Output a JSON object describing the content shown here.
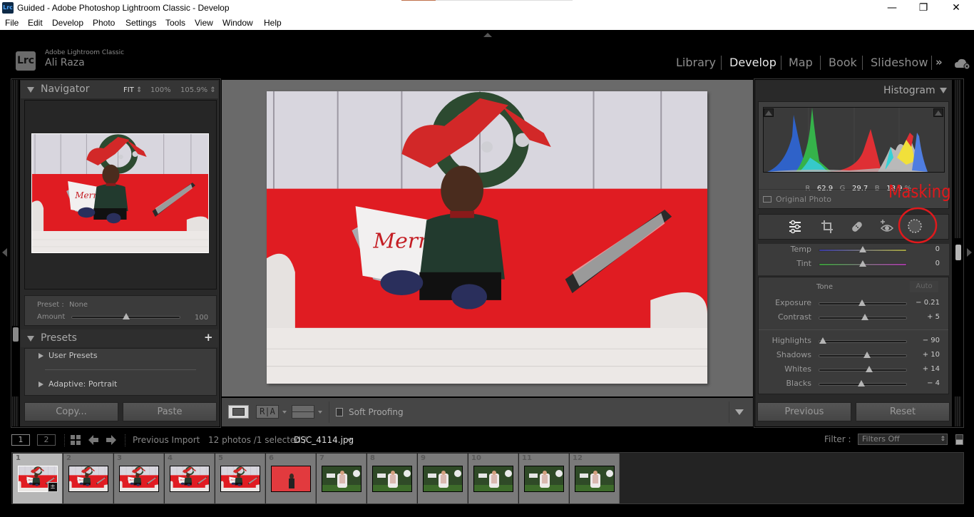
{
  "window": {
    "app_icon": "Lrc",
    "title": "Guided - Adobe Photoshop Lightroom Classic - Develop",
    "controls": {
      "minimize": "—",
      "restore": "❐",
      "close": "✕"
    }
  },
  "menu": [
    "File",
    "Edit",
    "Develop",
    "Photo",
    "Settings",
    "Tools",
    "View",
    "Window",
    "Help"
  ],
  "identity": {
    "badge": "Lrc",
    "product": "Adobe Lightroom Classic",
    "user": "Ali Raza"
  },
  "modules": {
    "items": [
      "Library",
      "Develop",
      "Map",
      "Book",
      "Slideshow"
    ],
    "active": "Develop",
    "more": "»",
    "cloud_icon": "cloud-sync-icon"
  },
  "navigator": {
    "title": "Navigator",
    "zoom_options": [
      "FIT",
      "100%",
      "105.9%"
    ],
    "selected_zoom": "FIT"
  },
  "preset_amount": {
    "preset_label": "Preset :",
    "preset_value": "None",
    "amount_label": "Amount",
    "amount_value": "100",
    "amount_fraction": 0.5
  },
  "presets": {
    "title": "Presets",
    "add": "+",
    "items": [
      "User Presets",
      "Adaptive: Portrait"
    ]
  },
  "left_buttons": {
    "copy": "Copy...",
    "paste": "Paste"
  },
  "toolbar": {
    "view_mode_icon": "loupe-view-icon",
    "before_after": "R|A",
    "before_after_split": "Y|Y",
    "soft_proofing": "Soft Proofing",
    "soft_proofing_checked": false
  },
  "histogram": {
    "title": "Histogram",
    "readout": {
      "r_label": "R",
      "r": "62.9",
      "g_label": "G",
      "g": "29.7",
      "b_label": "B",
      "b": "18.9",
      "unit": "%"
    },
    "original_photo": "Original Photo"
  },
  "annotation": {
    "text": "Masking",
    "color": "#e0191c"
  },
  "tool_strip": [
    "edit-sliders-icon",
    "crop-icon",
    "healing-icon",
    "red-eye-icon",
    "masking-icon"
  ],
  "basic": {
    "wb": [
      {
        "label": "Temp",
        "value": "0",
        "pos": 0.5
      },
      {
        "label": "Tint",
        "value": "0",
        "pos": 0.5
      }
    ],
    "tone_label": "Tone",
    "auto_label": "Auto",
    "tone": [
      {
        "label": "Exposure",
        "value": "− 0.21",
        "pos": 0.49
      },
      {
        "label": "Contrast",
        "value": "+ 5",
        "pos": 0.525
      }
    ],
    "presence": [
      {
        "label": "Highlights",
        "value": "− 90",
        "pos": 0.05
      },
      {
        "label": "Shadows",
        "value": "+ 10",
        "pos": 0.55
      },
      {
        "label": "Whites",
        "value": "+ 14",
        "pos": 0.57
      },
      {
        "label": "Blacks",
        "value": "− 4",
        "pos": 0.48
      }
    ]
  },
  "right_buttons": {
    "previous": "Previous",
    "reset": "Reset"
  },
  "filmbar": {
    "screen1": "1",
    "screen2": "2",
    "source": "Previous Import",
    "count": "12 photos /1 selected /",
    "filename": "DSC_4114.jpg",
    "filter_label": "Filter :",
    "filter_value": "Filters Off"
  },
  "filmstrip": [
    {
      "n": "1",
      "type": "sofa",
      "selected": true,
      "edited": true
    },
    {
      "n": "2",
      "type": "sofa"
    },
    {
      "n": "3",
      "type": "sofa"
    },
    {
      "n": "4",
      "type": "sofa"
    },
    {
      "n": "5",
      "type": "sofa"
    },
    {
      "n": "6",
      "type": "red"
    },
    {
      "n": "7",
      "type": "garden"
    },
    {
      "n": "8",
      "type": "garden"
    },
    {
      "n": "9",
      "type": "garden"
    },
    {
      "n": "10",
      "type": "garden"
    },
    {
      "n": "11",
      "type": "garden"
    },
    {
      "n": "12",
      "type": "garden"
    }
  ]
}
